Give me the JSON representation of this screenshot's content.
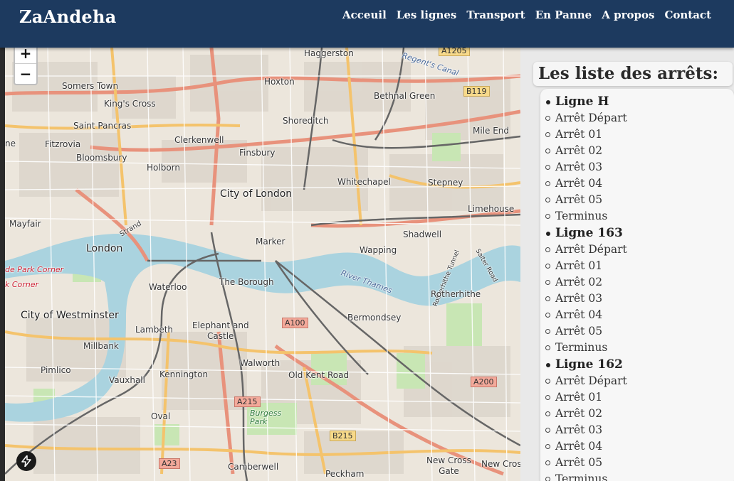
{
  "brand": "ZaAndeha",
  "nav": [
    "Acceuil",
    "Les lignes",
    "Transport",
    "En Panne",
    "A propos",
    "Contact"
  ],
  "map": {
    "zoom_in": "+",
    "zoom_out": "−",
    "labels": {
      "haggerston": "Haggerston",
      "a1205": "A1205",
      "somers_town": "Somers Town",
      "hoxton": "Hoxton",
      "regents_canal": "Regent's Canal",
      "b119": "B119",
      "bethnal_green": "Bethnal Green",
      "kings_cross": "King's Cross",
      "shoreditch": "Shoreditch",
      "saint_pancras": "Saint Pancras",
      "mile_end": "Mile End",
      "fitzrovia": "Fitzrovia",
      "clerkenwell": "Clerkenwell",
      "bloomsbury": "Bloomsbury",
      "finsbury": "Finsbury",
      "holborn": "Holborn",
      "whitechapel": "Whitechapel",
      "stepney": "Stepney",
      "city_of_london": "City of London",
      "limehouse": "Limehouse",
      "mayfair": "Mayfair",
      "strand": "Strand",
      "shadwell": "Shadwell",
      "london": "London",
      "wapping": "Wapping",
      "park_corner": "de Park Corner",
      "k_corner": "k Corner",
      "river_thames": "River Thames",
      "waterloo": "Waterloo",
      "the_borough": "The Borough",
      "rotherhithe_tunnel": "Rotherhithe Tunnel",
      "salter_road": "Salter Road",
      "rotherhithe": "Rotherhithe",
      "city_of_westminster": "City of Westminster",
      "bermondsey": "Bermondsey",
      "a100": "A100",
      "lambeth": "Lambeth",
      "elephant_and": "Elephant and",
      "castle": "Castle",
      "millbank": "Millbank",
      "walworth": "Walworth",
      "pimlico": "Pimlico",
      "old_kent_road": "Old Kent Road",
      "kennington": "Kennington",
      "vauxhall": "Vauxhall",
      "a200": "A200",
      "a215": "A215",
      "burgess_park": "Burgess\nPark",
      "oval": "Oval",
      "b215": "B215",
      "a23": "A23",
      "camberwell": "Camberwell",
      "new_cross_gate": "New Cross\nGate",
      "peckham": "Peckham",
      "new_cross": "New Cros",
      "marker": "Marker",
      "ne": "ne"
    }
  },
  "panel": {
    "title": "Les liste des arrêts:",
    "lines": [
      {
        "name": "Ligne H",
        "stops": [
          "Arrêt Départ",
          "Arrêt 01",
          "Arrêt 02",
          "Arrêt 03",
          "Arrêt 04",
          "Arrêt 05",
          "Terminus"
        ]
      },
      {
        "name": "Ligne 163",
        "stops": [
          "Arrêt Départ",
          "Arrêt 01",
          "Arrêt 02",
          "Arrêt 03",
          "Arrêt 04",
          "Arrêt 05",
          "Terminus"
        ]
      },
      {
        "name": "Ligne 162",
        "stops": [
          "Arrêt Départ",
          "Arrêt 01",
          "Arrêt 02",
          "Arrêt 03",
          "Arrêt 04",
          "Arrêt 05",
          "Terminus"
        ]
      }
    ]
  }
}
